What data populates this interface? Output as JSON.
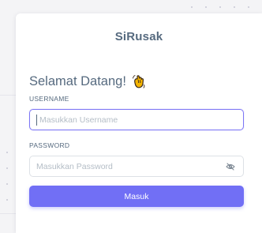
{
  "login": {
    "brand": "SiRusak",
    "welcome": "Selamat Datang!",
    "username_label": "USERNAME",
    "username_placeholder": "Masukkan Username",
    "password_label": "PASSWORD",
    "password_placeholder": "Masukkan Password",
    "submit_label": "Masuk"
  },
  "icons": {
    "greeting": "waving-hand-icon",
    "password_toggle": "eye-off-icon"
  },
  "colors": {
    "accent": "#716ff5",
    "text": "#566a7f",
    "focus_border": "#7d76f5"
  }
}
